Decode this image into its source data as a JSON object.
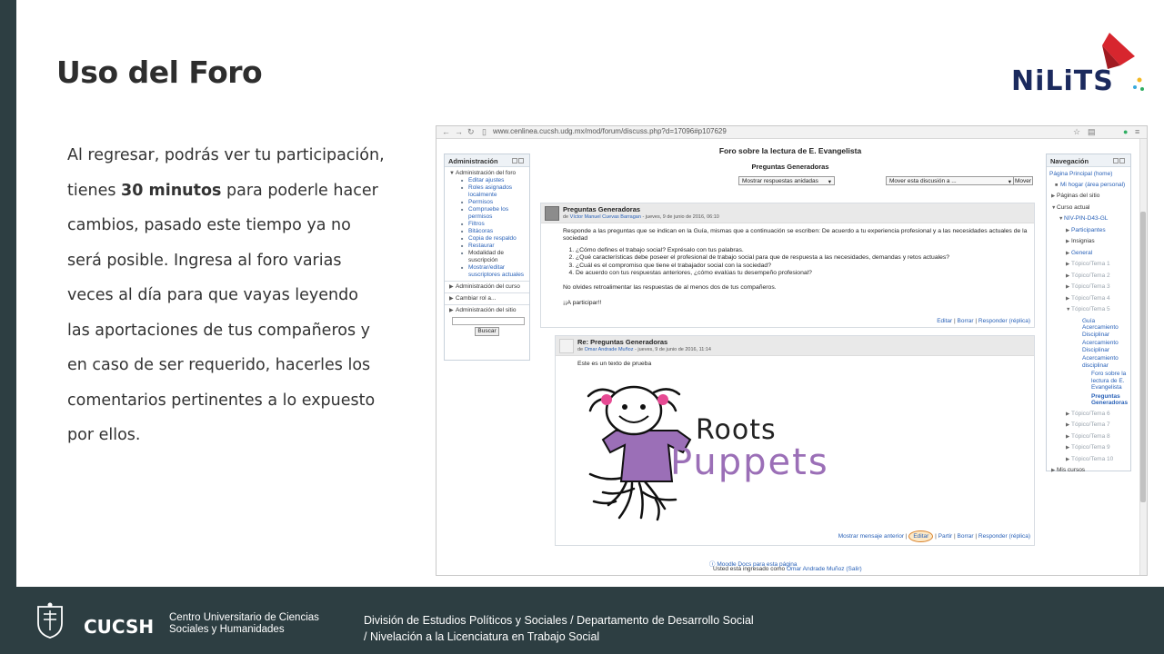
{
  "slide": {
    "title": "Uso del Foro",
    "body_before": "Al regresar, podrás ver tu participación, tienes ",
    "body_bold": "30 minutos",
    "body_after": " para poderle hacer cambios, pasado este tiempo ya no será posible. Ingresa al foro varias veces al día para que vayas leyendo las aportaciones de tus compañeros y en caso de ser requerido, hacerles los comentarios pertinentes a lo expuesto por ellos.",
    "logo_text": "NiLiTS"
  },
  "footer": {
    "org_short": "CUCSH",
    "org_line1": "Centro Universitario de Ciencias",
    "org_line2": "Sociales y Humanidades",
    "division_line1": "División de Estudios Políticos y Sociales / Departamento de Desarrollo Social",
    "division_line2": "/ Nivelación a la Licenciatura en Trabajo Social"
  },
  "browser": {
    "url": "www.cenlinea.cucsh.udg.mx/mod/forum/discuss.php?d=17096#p107629"
  },
  "admin_block": {
    "title": "Administración",
    "forum_admin": "Administración del foro",
    "links": [
      "Editar ajustes",
      "Roles asignados localmente",
      "Permisos",
      "Compruebe los permisos",
      "Filtros",
      "Bitácoras",
      "Copia de respaldo",
      "Restaurar"
    ],
    "modalidad": "Modalidad de suscripción",
    "mostrar": "Mostrar/editar suscriptores actuales",
    "course_admin": "Administración del curso",
    "change_role": "Cambiar rol a...",
    "site_admin": "Administración del sitio",
    "search_btn": "Buscar"
  },
  "forum": {
    "title": "Foro sobre la lectura de E. Evangelista",
    "subject": "Preguntas Generadoras",
    "display_select": "Mostrar respuestas anidadas",
    "move_select": "Mover esta discusión a ...",
    "move_btn": "Mover"
  },
  "post1": {
    "subject": "Preguntas Generadoras",
    "by": "de ",
    "author": "Víctor Manuel Cuevas Barragan",
    "date": " - jueves, 9 de junio de 2016, 06:10",
    "intro": "Responde a las preguntas que se indican en la Guía, mismas que a continuación se escriben: De acuerdo a tu experiencia profesional y a las necesidades actuales de la sociedad",
    "questions": [
      "¿Cómo defines el trabajo social? Exprésalo con tus palabras.",
      "¿Qué características debe poseer el profesional de trabajo social para que de respuesta a las necesidades, demandas y retos actuales?",
      "¿Cuál es el compromiso que tiene el trabajador social con la sociedad?",
      "De acuerdo con tus respuestas anteriores, ¿cómo evalúas tu desempeño profesional?"
    ],
    "note": "No olvides retroalimentar las respuestas de al menos dos de tus compañeros.",
    "closing": "¡¡A participar!!",
    "edit": "Editar",
    "delete": "Borrar",
    "reply": "Responder (réplica)"
  },
  "post2": {
    "subject": "Re: Preguntas Generadoras",
    "by": "de ",
    "author": "Omar Andrade Muñoz",
    "date": " - jueves, 9 de junio de 2016, 11:14",
    "body": "Este es un texto de prueba",
    "image_text1": "Roots",
    "image_text2": "Puppets",
    "prev": "Mostrar mensaje anterior",
    "edit": "Editar",
    "split": "Partir",
    "delete": "Borrar",
    "reply": "Responder (réplica)"
  },
  "nav_block": {
    "title": "Navegación",
    "home": "Página Principal (home)",
    "my_home": "Mi hogar (área personal)",
    "site_pages": "Páginas del sitio",
    "current_course": "Curso actual",
    "course_code": "NIV-PIN-D43-GL",
    "participants": "Participantes",
    "badges": "Insignias",
    "general": "General",
    "topics_a": [
      "Tópico/Tema 1",
      "Tópico/Tema 2",
      "Tópico/Tema 3",
      "Tópico/Tema 4",
      "Tópico/Tema 5"
    ],
    "guide": "Guía Acercamiento Disciplinar",
    "approach1": "Acercamiento Disciplinar",
    "approach2": "Acercamiento disciplinar",
    "forum": "Foro sobre la lectura de E. Evangelista",
    "questions": "Preguntas Generadoras",
    "topics_b": [
      "Tópico/Tema 6",
      "Tópico/Tema 7",
      "Tópico/Tema 8",
      "Tópico/Tema 9",
      "Tópico/Tema 10"
    ],
    "my_courses": "Mis cursos"
  },
  "page_footer": {
    "docs": "Moodle Docs para esta página",
    "logged_prefix": "Usted está ingresado como ",
    "user": "Omar Andrade Muñoz",
    "logout": " (Salir)"
  }
}
